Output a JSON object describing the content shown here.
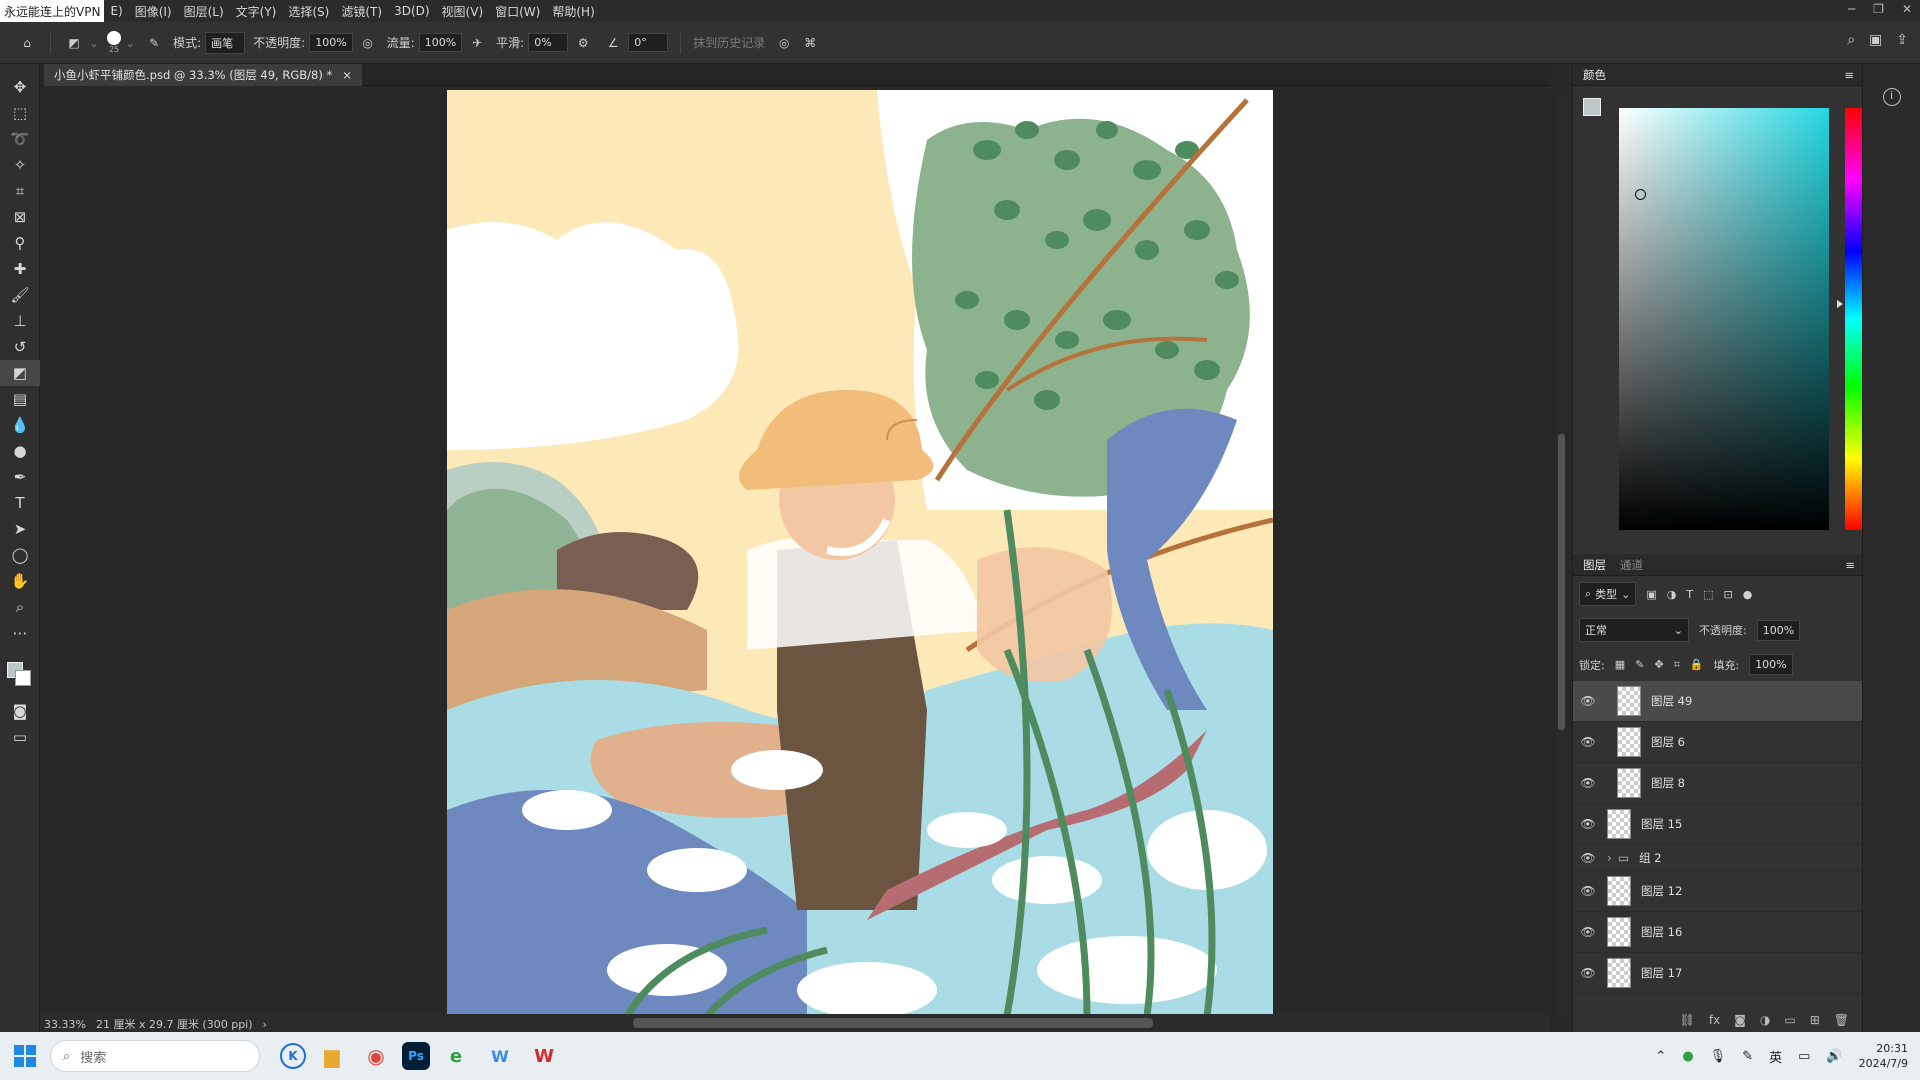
{
  "menubar": {
    "vpn_label": "永远能连上的VPN",
    "items": [
      "E)",
      "图像(I)",
      "图层(L)",
      "文字(Y)",
      "选择(S)",
      "滤镜(T)",
      "3D(D)",
      "视图(V)",
      "窗口(W)",
      "帮助(H)"
    ]
  },
  "options": {
    "brush_size": "25",
    "mode_label": "模式:",
    "mode_value": "画笔",
    "opacity_label": "不透明度:",
    "opacity_value": "100%",
    "flow_label": "流量:",
    "flow_value": "100%",
    "smooth_label": "平滑:",
    "smooth_value": "0%",
    "angle_value": "0°",
    "history_label": "抹到历史记录"
  },
  "document": {
    "tab_title": "小鱼小虾平铺颜色.psd @ 33.3% (图层 49, RGB/8) *",
    "zoom": "33.33%",
    "size_info": "21 厘米 x 29.7 厘米 (300 ppi)"
  },
  "color_panel": {
    "title": "颜色",
    "fg_color": "#bfc6c8",
    "hue_color": "#25d7e2"
  },
  "layers_panel": {
    "tab_layers": "图层",
    "tab_channels": "通道",
    "filter_value": "类型",
    "blend_mode": "正常",
    "opacity_label": "不透明度:",
    "opacity_value": "100%",
    "lock_label": "锁定:",
    "fill_label": "填充:",
    "fill_value": "100%",
    "layers": [
      {
        "name": "图层 49",
        "selected": true,
        "indent": true
      },
      {
        "name": "图层 6",
        "selected": false,
        "indent": true
      },
      {
        "name": "图层 8",
        "selected": false,
        "indent": true
      },
      {
        "name": "图层 15",
        "selected": false,
        "indent": false
      },
      {
        "name": "组 2",
        "group": true
      },
      {
        "name": "图层 12",
        "selected": false,
        "indent": false
      },
      {
        "name": "图层 16",
        "selected": false,
        "indent": false
      },
      {
        "name": "图层 17",
        "selected": false,
        "indent": false
      }
    ]
  },
  "taskbar": {
    "search_placeholder": "搜索",
    "ime": "英",
    "time": "20:31",
    "date": "2024/7/9"
  }
}
